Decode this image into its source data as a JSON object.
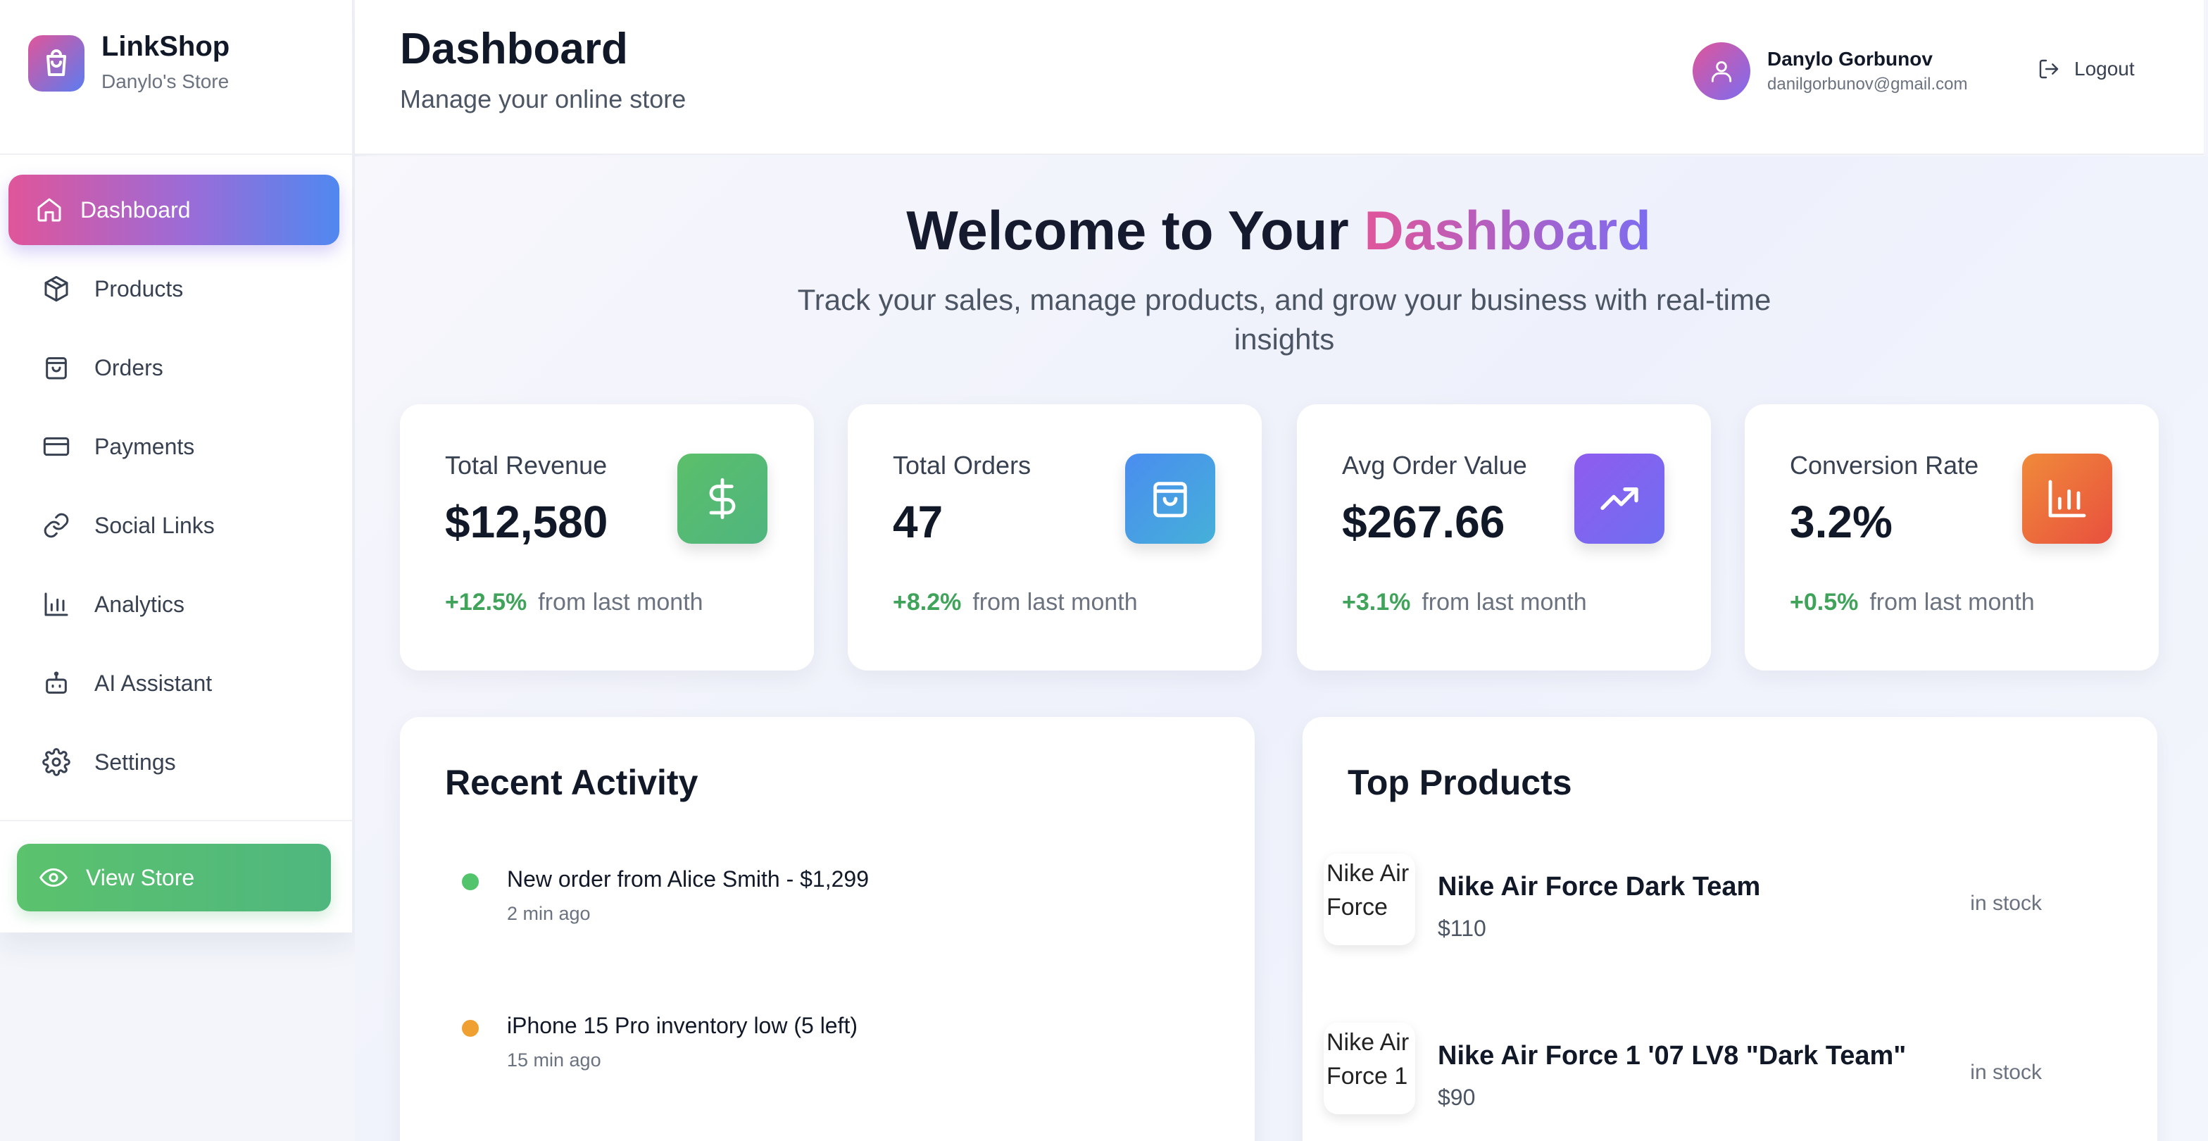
{
  "brand": {
    "name": "LinkShop",
    "store": "Danylo's Store"
  },
  "nav": {
    "items": [
      {
        "label": "Dashboard",
        "icon": "home-icon",
        "active": true
      },
      {
        "label": "Products",
        "icon": "box-icon"
      },
      {
        "label": "Orders",
        "icon": "bag-icon"
      },
      {
        "label": "Payments",
        "icon": "credit-card-icon"
      },
      {
        "label": "Social Links",
        "icon": "link-icon"
      },
      {
        "label": "Analytics",
        "icon": "bar-chart-icon"
      },
      {
        "label": "AI Assistant",
        "icon": "robot-icon"
      },
      {
        "label": "Settings",
        "icon": "gear-icon"
      }
    ],
    "view_store": "View Store"
  },
  "header": {
    "title": "Dashboard",
    "subtitle": "Manage your online store",
    "user_name": "Danylo Gorbunov",
    "user_email": "danilgorbunov@gmail.com",
    "logout": "Logout"
  },
  "welcome": {
    "title_prefix": "Welcome to Your ",
    "title_highlight": "Dashboard",
    "subtitle": "Track your sales, manage products, and grow your business with real-time insights"
  },
  "stats": [
    {
      "label": "Total Revenue",
      "value": "$12,580",
      "change": "+12.5%",
      "suffix": "from last month",
      "icon": "dollar-icon",
      "color": "#5bbf6a"
    },
    {
      "label": "Total Orders",
      "value": "47",
      "change": "+8.2%",
      "suffix": "from last month",
      "icon": "bag-icon",
      "color": "#4a8df0"
    },
    {
      "label": "Avg Order Value",
      "value": "$267.66",
      "change": "+3.1%",
      "suffix": "from last month",
      "icon": "trending-up-icon",
      "color": "#9a5cf0"
    },
    {
      "label": "Conversion Rate",
      "value": "3.2%",
      "change": "+0.5%",
      "suffix": "from last month",
      "icon": "bar-chart-icon",
      "color": "#f06a3a"
    }
  ],
  "activity": {
    "title": "Recent Activity",
    "items": [
      {
        "text": "New order from Alice Smith - $1,299",
        "time": "2 min ago",
        "color": "#52c46b"
      },
      {
        "text": "iPhone 15 Pro inventory low (5 left)",
        "time": "15 min ago",
        "color": "#f0a030"
      }
    ]
  },
  "top_products": {
    "title": "Top Products",
    "items": [
      {
        "alt": "Nike Air Force",
        "name": "Nike Air Force Dark Team",
        "price": "$110",
        "stock": "in stock"
      },
      {
        "alt": "Nike Air Force 1",
        "name": "Nike Air Force 1 '07 LV8 \"Dark Team\"",
        "price": "$90",
        "stock": "in stock"
      }
    ]
  }
}
